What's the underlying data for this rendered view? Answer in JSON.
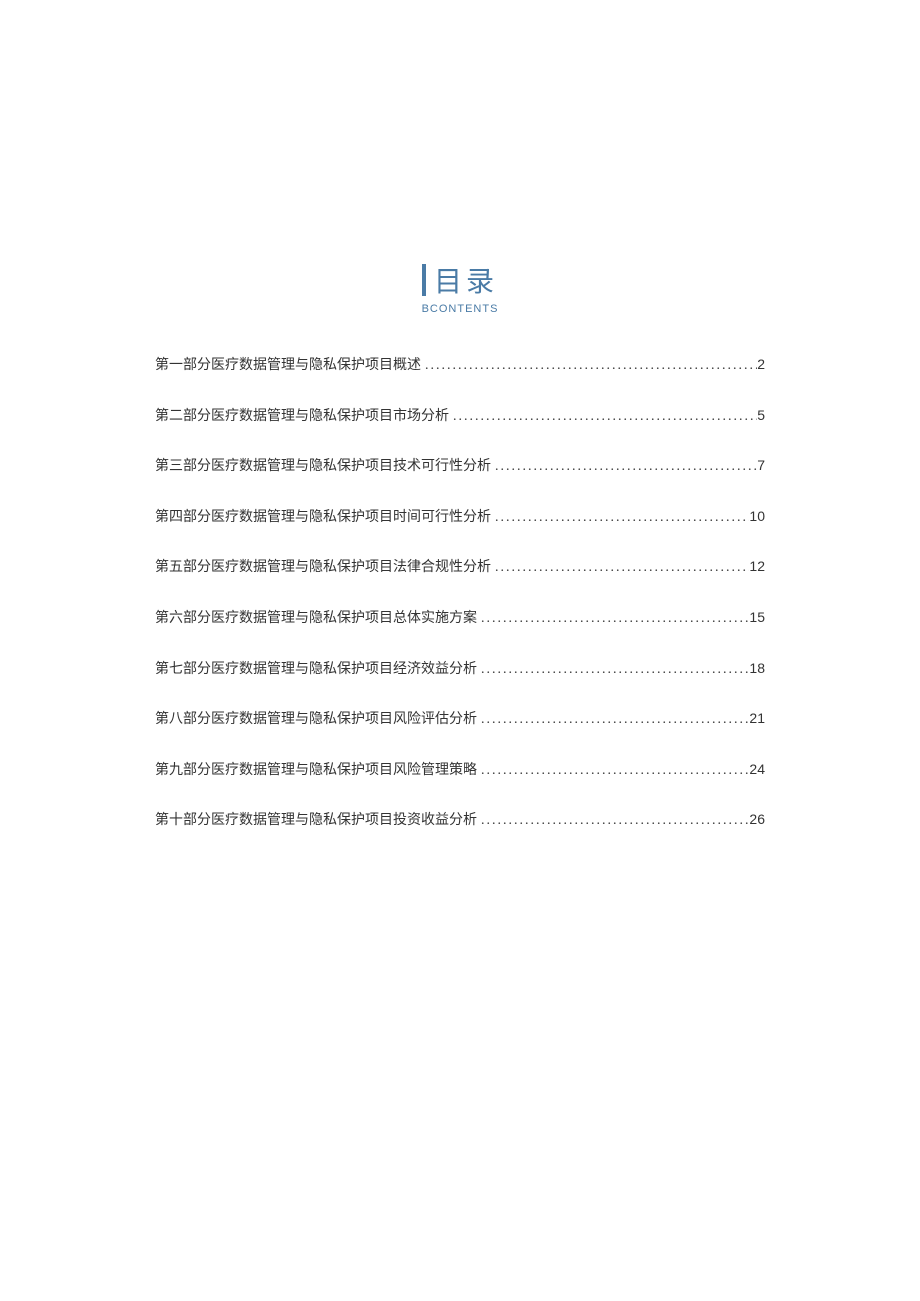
{
  "header": {
    "title": "目录",
    "subtitle": "BCONTENTS"
  },
  "toc": [
    {
      "label": "第一部分医疗数据管理与隐私保护项目概述",
      "page": "2"
    },
    {
      "label": "第二部分医疗数据管理与隐私保护项目市场分析",
      "page": "5"
    },
    {
      "label": "第三部分医疗数据管理与隐私保护项目技术可行性分析",
      "page": "7"
    },
    {
      "label": "第四部分医疗数据管理与隐私保护项目时间可行性分析",
      "page": "10"
    },
    {
      "label": "第五部分医疗数据管理与隐私保护项目法律合规性分析",
      "page": "12"
    },
    {
      "label": "第六部分医疗数据管理与隐私保护项目总体实施方案",
      "page": "15"
    },
    {
      "label": "第七部分医疗数据管理与隐私保护项目经济效益分析",
      "page": "18"
    },
    {
      "label": "第八部分医疗数据管理与隐私保护项目风险评估分析",
      "page": "21"
    },
    {
      "label": "第九部分医疗数据管理与隐私保护项目风险管理策略",
      "page": "24"
    },
    {
      "label": "第十部分医疗数据管理与隐私保护项目投资收益分析",
      "page": "26"
    }
  ]
}
